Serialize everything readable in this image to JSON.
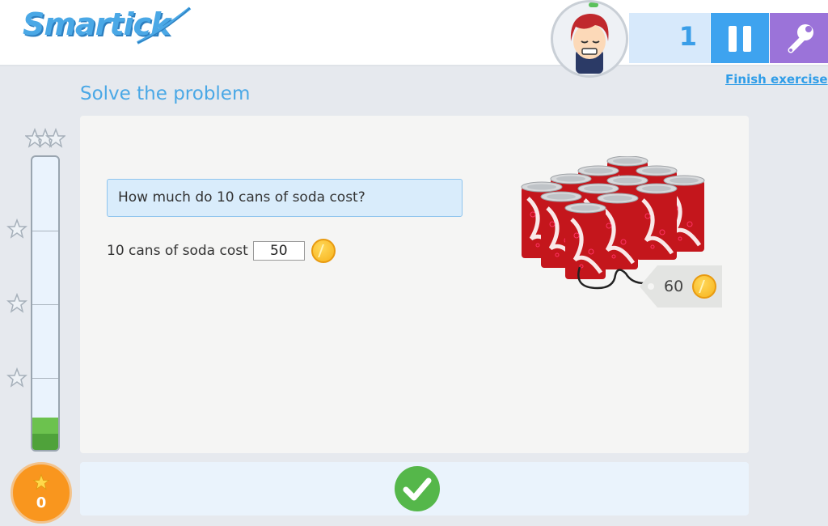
{
  "app": {
    "logo_text": "Smartick"
  },
  "header": {
    "score": "1",
    "finish_label": "Finish exercise"
  },
  "exercise": {
    "heading": "Solve the problem",
    "question": "How much do 10 cans of soda cost?",
    "answer_label": "10 cans of soda cost",
    "answer_value": "50",
    "price_tag_value": "60"
  },
  "progress": {
    "stars_earned": "0",
    "meter_fill_fraction": 0.11
  },
  "colors": {
    "accent_blue": "#3ea3ef",
    "tool_purple": "#9b73d9",
    "check_green": "#55b74a",
    "lives_orange": "#f9961e"
  },
  "icons": {
    "pause": "pause-icon",
    "tool": "wrench-icon",
    "check": "checkmark-icon",
    "coin": "coin-icon",
    "star": "star-icon"
  }
}
